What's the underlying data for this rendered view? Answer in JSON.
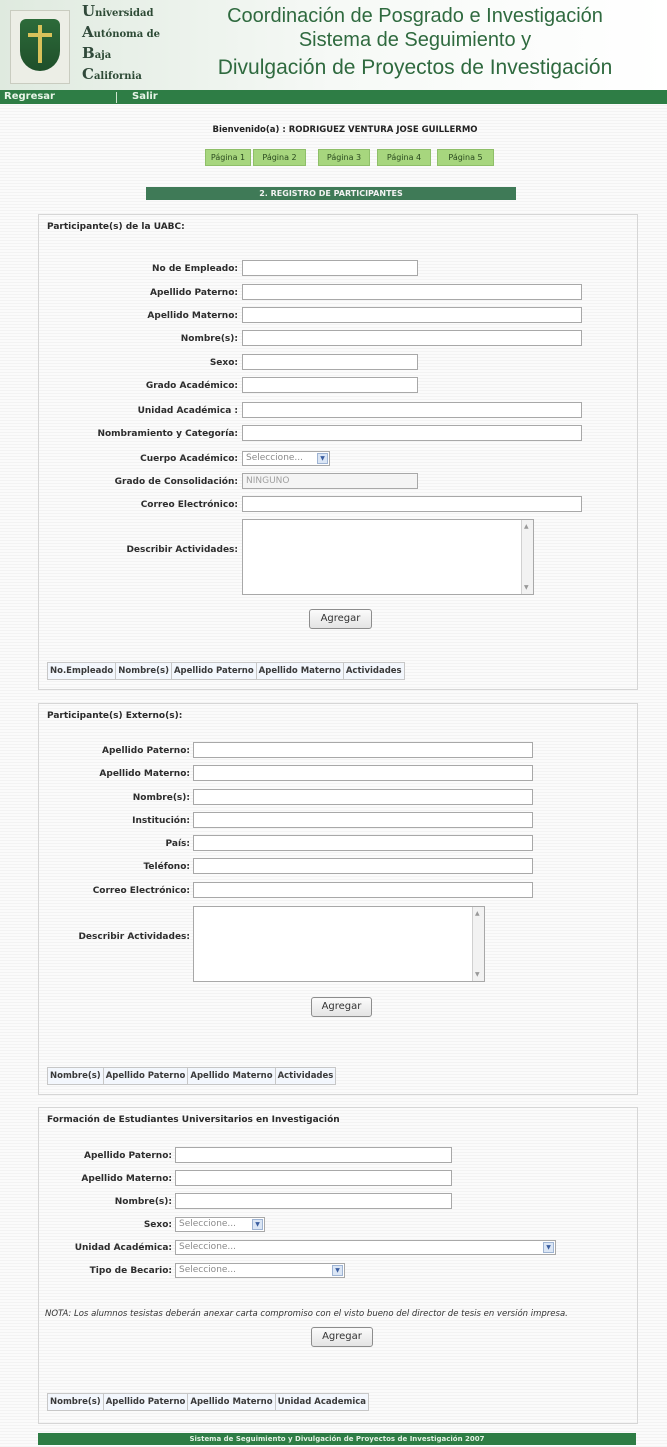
{
  "header": {
    "university": [
      {
        "cap": "U",
        "rest": "niversidad"
      },
      {
        "cap": "A",
        "rest": "utónoma de"
      },
      {
        "cap": "B",
        "rest": "aja"
      },
      {
        "cap": "C",
        "rest": "alifornia"
      }
    ],
    "title_line1": "Coordinación de Posgrado e Investigación",
    "title_line2": "Sistema de Seguimiento y",
    "title_line3": "Divulgación de Proyectos de Investigación"
  },
  "topnav": {
    "back": "Regresar",
    "exit": "Salir"
  },
  "welcome": "Bienvenido(a) : RODRIGUEZ VENTURA JOSE GUILLERMO",
  "pages": [
    "Página 1",
    "Página 2",
    "Página 3",
    "Página 4",
    "Página 5"
  ],
  "section_title": "2. REGISTRO DE PARTICIPANTES",
  "uabc": {
    "title": "Participante(s) de la UABC:",
    "labels": {
      "empleado": "No de Empleado:",
      "paterno": "Apellido Paterno:",
      "materno": "Apellido Materno:",
      "nombre": "Nombre(s):",
      "sexo": "Sexo:",
      "grado": "Grado Académico:",
      "unidad": "Unidad Académica :",
      "nombramiento": "Nombramiento y Categoría:",
      "cuerpo": "Cuerpo Académico:",
      "consolidacion": "Grado de Consolidación:",
      "correo": "Correo Electrónico:",
      "actividades": "Describir Actividades:"
    },
    "cuerpo_value": "Seleccione...",
    "consolidacion_value": "NINGUNO",
    "add_button": "Agregar",
    "columns": [
      "No.Empleado",
      "Nombre(s)",
      "Apellido Paterno",
      "Apellido Materno",
      "Actividades"
    ]
  },
  "externos": {
    "title": "Participante(s) Externo(s):",
    "labels": {
      "paterno": "Apellido Paterno:",
      "materno": "Apellido Materno:",
      "nombre": "Nombre(s):",
      "institucion": "Institución:",
      "pais": "País:",
      "telefono": "Teléfono:",
      "correo": "Correo Electrónico:",
      "actividades": "Describir Actividades:"
    },
    "add_button": "Agregar",
    "columns": [
      "Nombre(s)",
      "Apellido Paterno",
      "Apellido Materno",
      "Actividades"
    ]
  },
  "estudiantes": {
    "title": "Formación de Estudiantes Universitarios en Investigación",
    "labels": {
      "paterno": "Apellido Paterno:",
      "materno": "Apellido Materno:",
      "nombre": "Nombre(s):",
      "sexo": "Sexo:",
      "unidad": "Unidad Académica:",
      "becario": "Tipo de Becario:"
    },
    "sexo_value": "Seleccione...",
    "unidad_value": "Seleccione...",
    "becario_value": "Seleccione...",
    "nota": "NOTA: Los alumnos tesistas deberán anexar carta compromiso con el visto bueno del director de tesis en versión impresa.",
    "add_button": "Agregar",
    "columns": [
      "Nombre(s)",
      "Apellido Paterno",
      "Apellido Materno",
      "Unidad Academica"
    ]
  },
  "footer": "Sistema de Seguimiento y Divulgación de Proyectos de Investigación 2007"
}
